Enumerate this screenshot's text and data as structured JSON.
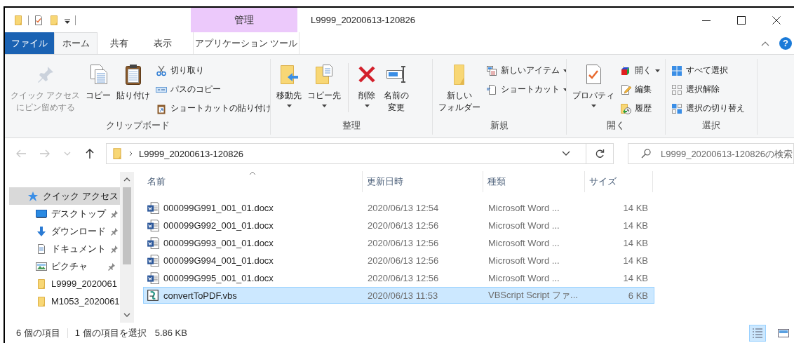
{
  "title_bar": {
    "context_tab": "管理",
    "title": "L9999_20200613-120826"
  },
  "tabs": [
    {
      "label": "ファイル",
      "kind": "file",
      "selected": false
    },
    {
      "label": "ホーム",
      "kind": "normal",
      "selected": true
    },
    {
      "label": "共有",
      "kind": "normal",
      "selected": false
    },
    {
      "label": "表示",
      "kind": "normal",
      "selected": false
    },
    {
      "label": "アプリケーション ツール",
      "kind": "context",
      "selected": false
    }
  ],
  "help": "?",
  "ribbon": {
    "groups": [
      {
        "label": "クリップボード",
        "items": [
          {
            "kind": "large",
            "lines": [
              "クイック アクセス",
              "にピン留めする"
            ],
            "disabled": true,
            "dropdown": false
          },
          {
            "kind": "large",
            "lines": [
              "コピー"
            ],
            "disabled": false,
            "dropdown": false
          },
          {
            "kind": "large",
            "lines": [
              "貼り付け"
            ],
            "disabled": false,
            "dropdown": false
          },
          {
            "kind": "small",
            "label": "切り取り",
            "disabled": false,
            "dropdown": false
          },
          {
            "kind": "small",
            "label": "パスのコピー",
            "disabled": false,
            "dropdown": false
          },
          {
            "kind": "small",
            "label": "ショートカットの貼り付け",
            "disabled": false,
            "dropdown": false
          }
        ]
      },
      {
        "label": "整理",
        "items": [
          {
            "kind": "large",
            "lines": [
              "移動先"
            ],
            "disabled": false,
            "dropdown": true
          },
          {
            "kind": "large",
            "lines": [
              "コピー先"
            ],
            "disabled": false,
            "dropdown": true
          },
          {
            "kind": "separator"
          },
          {
            "kind": "large",
            "lines": [
              "削除"
            ],
            "disabled": false,
            "dropdown": true
          },
          {
            "kind": "large",
            "lines": [
              "名前の",
              "変更"
            ],
            "disabled": false,
            "dropdown": false
          }
        ]
      },
      {
        "label": "新規",
        "items": [
          {
            "kind": "large",
            "lines": [
              "新しい",
              "フォルダー"
            ],
            "disabled": false,
            "dropdown": false
          },
          {
            "kind": "small",
            "label": "新しいアイテム",
            "disabled": false,
            "dropdown": true
          },
          {
            "kind": "small",
            "label": "ショートカット",
            "disabled": false,
            "dropdown": true
          }
        ]
      },
      {
        "label": "開く",
        "items": [
          {
            "kind": "large",
            "lines": [
              "プロパティ"
            ],
            "disabled": false,
            "dropdown": true
          },
          {
            "kind": "small",
            "label": "開く",
            "disabled": false,
            "dropdown": true
          },
          {
            "kind": "small",
            "label": "編集",
            "disabled": false,
            "dropdown": false
          },
          {
            "kind": "small",
            "label": "履歴",
            "disabled": false,
            "dropdown": false
          }
        ]
      },
      {
        "label": "選択",
        "items": [
          {
            "kind": "small",
            "label": "すべて選択",
            "disabled": false,
            "dropdown": false
          },
          {
            "kind": "small",
            "label": "選択解除",
            "disabled": false,
            "dropdown": false
          },
          {
            "kind": "small",
            "label": "選択の切り替え",
            "disabled": false,
            "dropdown": false
          }
        ]
      }
    ]
  },
  "nav_buttons": [
    {
      "kind": "back",
      "disabled": true
    },
    {
      "kind": "forward",
      "disabled": true
    },
    {
      "kind": "recent",
      "disabled": true
    },
    {
      "kind": "up",
      "disabled": false
    }
  ],
  "address": {
    "path": "L9999_20200613-120826"
  },
  "search": {
    "placeholder": "L9999_20200613-120826の検索"
  },
  "nav_pane": {
    "items": [
      {
        "label": "クイック アクセス",
        "kind": "star",
        "selected": true,
        "children": [
          {
            "label": "デスクトップ",
            "kind": "desktop",
            "selected": false,
            "pinned": true
          },
          {
            "label": "ダウンロード",
            "kind": "download",
            "selected": false,
            "pinned": true
          },
          {
            "label": "ドキュメント",
            "kind": "document",
            "selected": false,
            "pinned": true
          },
          {
            "label": "ピクチャ",
            "kind": "picture",
            "selected": false,
            "pinned": true
          },
          {
            "label": "L9999_2020061",
            "kind": "folder",
            "selected": false
          },
          {
            "label": "M1053_2020061",
            "kind": "folder",
            "selected": false
          }
        ]
      }
    ]
  },
  "table": {
    "columns": [
      {
        "label": "名前",
        "sorted": true
      },
      {
        "label": "更新日時",
        "sorted": false
      },
      {
        "label": "種類",
        "sorted": false
      },
      {
        "label": "サイズ",
        "sorted": false
      }
    ],
    "rows": [
      {
        "kind": "word",
        "name": "000099G991_001_01.docx",
        "modified": "2020/06/13 12:54",
        "type": "Microsoft Word ...",
        "size": "14 KB",
        "selected": false
      },
      {
        "kind": "word",
        "name": "000099G992_001_01.docx",
        "modified": "2020/06/13 12:56",
        "type": "Microsoft Word ...",
        "size": "14 KB",
        "selected": false
      },
      {
        "kind": "word",
        "name": "000099G993_001_01.docx",
        "modified": "2020/06/13 12:56",
        "type": "Microsoft Word ...",
        "size": "14 KB",
        "selected": false
      },
      {
        "kind": "word",
        "name": "000099G994_001_01.docx",
        "modified": "2020/06/13 12:56",
        "type": "Microsoft Word ...",
        "size": "14 KB",
        "selected": false
      },
      {
        "kind": "word",
        "name": "000099G995_001_01.docx",
        "modified": "2020/06/13 12:56",
        "type": "Microsoft Word ...",
        "size": "14 KB",
        "selected": false
      },
      {
        "kind": "script",
        "name": "convertToPDF.vbs",
        "modified": "2020/06/13 11:53",
        "type": "VBScript Script ファ...",
        "size": "6 KB",
        "selected": true
      }
    ]
  },
  "status_bar": {
    "item_count": "6 個の項目",
    "selection": "1 個の項目を選択",
    "selection_size": "5.86 KB",
    "views": [
      {
        "kind": "details",
        "selected": true
      },
      {
        "kind": "large-icons",
        "selected": false
      }
    ]
  }
}
